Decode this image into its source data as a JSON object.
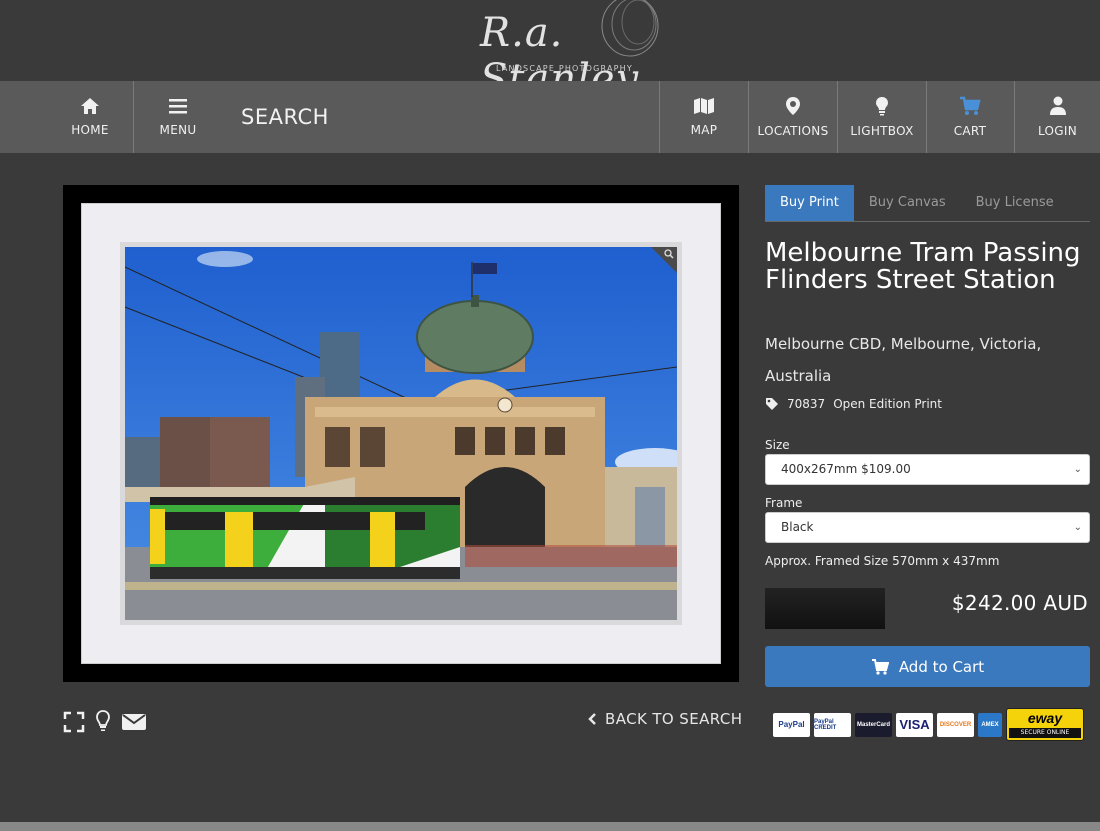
{
  "brand": {
    "logo_script": "R.a. Stanley",
    "logo_sub": "LANDSCAPE PHOTOGRAPHY"
  },
  "nav": {
    "home": "HOME",
    "menu": "MENU",
    "search": "SEARCH",
    "map": "MAP",
    "locations": "LOCATIONS",
    "lightbox": "LIGHTBOX",
    "cart": "CART",
    "login": "LOGIN"
  },
  "tabs": [
    "Buy Print",
    "Buy Canvas",
    "Buy License"
  ],
  "product": {
    "title": "Melbourne Tram Passing Flinders Street Station",
    "location": "Melbourne CBD, Melbourne, Victoria, Australia",
    "code": "70837",
    "edition": "Open Edition Print",
    "size_label": "Size",
    "size_value": "400x267mm $109.00",
    "frame_label": "Frame",
    "frame_value": "Black",
    "approx": "Approx. Framed Size 570mm x 437mm",
    "price": "$242.00 AUD",
    "add_to_cart": "Add to Cart"
  },
  "back_to_search": "BACK TO SEARCH",
  "payments": {
    "paypal": "PayPal",
    "paypal_credit": "PayPal CREDIT",
    "mastercard": "MasterCard",
    "visa": "VISA",
    "discover": "DISCOVER",
    "amex": "AMEX",
    "eway": "eway",
    "eway_sub": "SECURE ONLINE"
  },
  "colors": {
    "accent": "#3a79bd",
    "nav_bg": "#5a5a5a",
    "page_bg": "#3a3a3a",
    "cart_icon": "#4a90d9"
  },
  "icons": [
    "home-icon",
    "menu-icon",
    "map-icon",
    "location-pin-icon",
    "lightbulb-icon",
    "cart-icon",
    "user-icon",
    "fullscreen-icon",
    "lightbox-add-icon",
    "email-icon",
    "tag-icon",
    "chevron-left-icon",
    "zoom-icon"
  ]
}
